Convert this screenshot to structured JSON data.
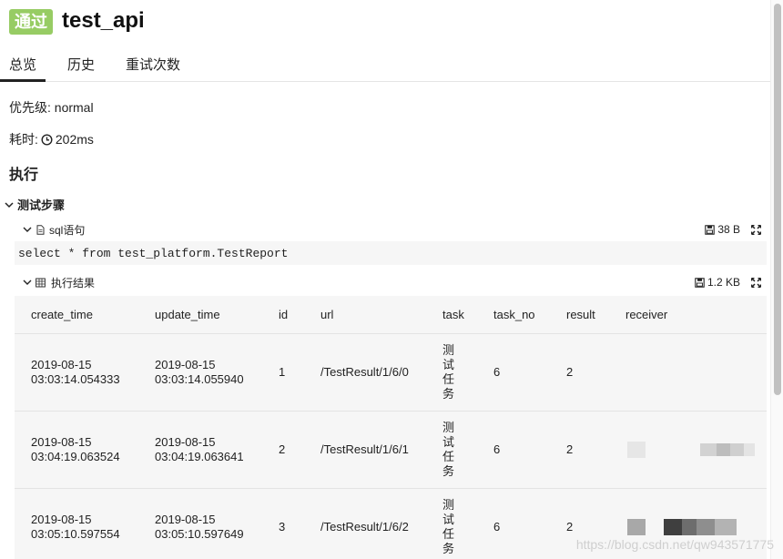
{
  "header": {
    "status_badge": "通过",
    "title": "test_api"
  },
  "tabs": [
    {
      "label": "总览"
    },
    {
      "label": "历史"
    },
    {
      "label": "重试次数"
    }
  ],
  "overview": {
    "priority_label": "优先级: normal",
    "duration_label": "耗时:",
    "duration_value": "202ms"
  },
  "execution": {
    "section_title": "执行",
    "step_title": "测试步骤",
    "sql_attachment": {
      "label": "sql语句",
      "size": "38 B",
      "content": "select * from test_platform.TestReport"
    },
    "result_attachment": {
      "label": "执行结果",
      "size": "1.2 KB"
    },
    "table": {
      "columns": [
        "create_time",
        "update_time",
        "id",
        "url",
        "task",
        "task_no",
        "result",
        "receiver"
      ],
      "rows": [
        {
          "create_time_date": "2019-08-15",
          "create_time_time": "03:03:14.054333",
          "update_time_date": "2019-08-15",
          "update_time_time": "03:03:14.055940",
          "id": "1",
          "url": "/TestResult/1/6/0",
          "task": "测试任务",
          "task_no": "6",
          "result": "2"
        },
        {
          "create_time_date": "2019-08-15",
          "create_time_time": "03:04:19.063524",
          "update_time_date": "2019-08-15",
          "update_time_time": "03:04:19.063641",
          "id": "2",
          "url": "/TestResult/1/6/1",
          "task": "测试任务",
          "task_no": "6",
          "result": "2"
        },
        {
          "create_time_date": "2019-08-15",
          "create_time_time": "03:05:10.597554",
          "update_time_date": "2019-08-15",
          "update_time_time": "03:05:10.597649",
          "id": "3",
          "url": "/TestResult/1/6/2",
          "task": "测试任务",
          "task_no": "6",
          "result": "2"
        }
      ]
    }
  },
  "watermark": "https://blog.csdn.net/qw943571775",
  "colors": {
    "badge_green": "#97cc64",
    "block_bg": "#f6f6f6"
  },
  "icons": {
    "duration": "clock-icon",
    "sql": "file-icon",
    "result": "table-icon",
    "size": "disk-icon",
    "expand": "fullscreen-icon",
    "collapse": "chevron-down-icon"
  }
}
